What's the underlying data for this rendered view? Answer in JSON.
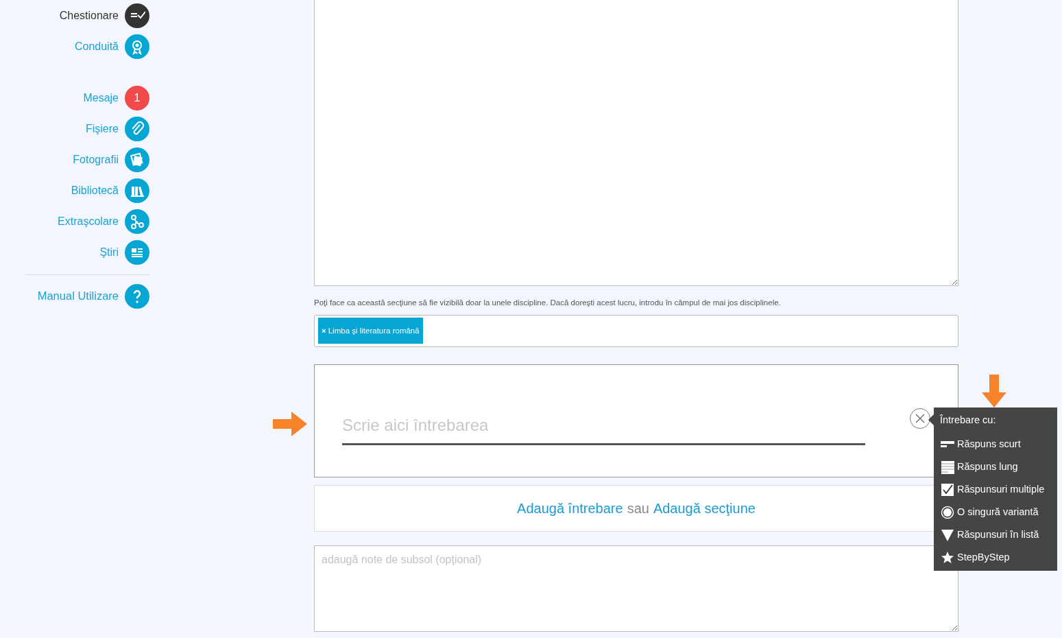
{
  "sidebar": {
    "sections": [
      {
        "items": [
          {
            "label": "Chestionare",
            "selected": true
          },
          {
            "label": "Conduită",
            "selected": false
          }
        ]
      },
      {
        "items": [
          {
            "label": "Mesaje",
            "selected": false,
            "badge": "1"
          },
          {
            "label": "Fişiere",
            "selected": false
          },
          {
            "label": "Fotografii",
            "selected": false
          },
          {
            "label": "Bibliotecă",
            "selected": false
          },
          {
            "label": "Extraşcolare",
            "selected": false
          },
          {
            "label": "Ştiri",
            "selected": false
          }
        ]
      }
    ],
    "footer_item": {
      "label": "Manual Utilizare"
    }
  },
  "section_editor": {
    "visibility_hint": "Poţi face ca această secţiune să fie vizibilă doar la unele discipline. Dacă doreşti acest lucru, introdu în câmpul de mai jos disciplinele.",
    "tags": [
      {
        "remove": "×",
        "label": "Limba şi literatura română"
      }
    ],
    "question": {
      "placeholder": "Scrie aici întrebarea"
    },
    "add_row": {
      "add_question": "Adaugă întrebare",
      "separator": "sau",
      "add_section": "Adaugă secţiune"
    },
    "footnote": {
      "placeholder": "adaugă note de subsol (opţional)"
    }
  },
  "question_type_menu": {
    "title": "Întrebare cu:",
    "options": [
      {
        "label": "Răspuns scurt"
      },
      {
        "label": "Răspuns lung"
      },
      {
        "label": "Răspunsuri multiple"
      },
      {
        "label": "O singură variantă"
      },
      {
        "label": "Răspunsuri în listă"
      },
      {
        "label": "StepByStep"
      }
    ]
  }
}
